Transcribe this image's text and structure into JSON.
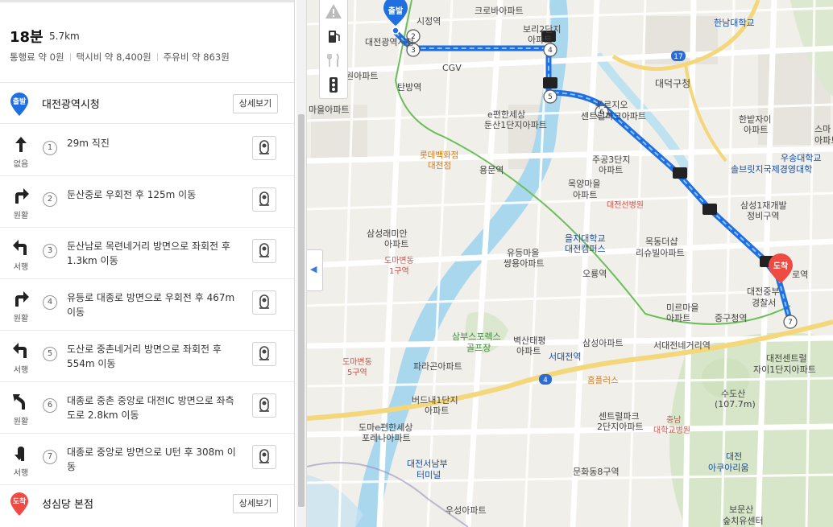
{
  "summary": {
    "duration": "18분",
    "distance": "5.7km",
    "toll": "통행료 약 0원",
    "taxi": "택시비 약 8,400원",
    "fuel": "주유비 약 863원"
  },
  "origin": {
    "badge": "출발",
    "name": "대전광역시청",
    "detail_label": "상세보기"
  },
  "destination": {
    "badge": "도착",
    "name": "성심당 본점",
    "detail_label": "상세보기"
  },
  "steps": [
    {
      "num": "1",
      "turn": "straight",
      "turn_label": "없음",
      "text": "29m 직진"
    },
    {
      "num": "2",
      "turn": "right",
      "turn_label": "원활",
      "text": "둔산중로 우회전 후 125m 이동"
    },
    {
      "num": "3",
      "turn": "left",
      "turn_label": "서행",
      "text": "둔산남로 목련네거리 방면으로 좌회전 후 1.3km 이동"
    },
    {
      "num": "4",
      "turn": "right",
      "turn_label": "원활",
      "text": "유등로 대종로 방면으로 우회전 후 467m 이동"
    },
    {
      "num": "5",
      "turn": "left",
      "turn_label": "서행",
      "text": "도산로 중촌네거리 방면으로 좌회전 후 554m 이동"
    },
    {
      "num": "6",
      "turn": "slight-left",
      "turn_label": "원활",
      "text": "대종로 중촌 중앙로 대전IC 방면으로 좌측도로 2.8km 이동"
    },
    {
      "num": "7",
      "turn": "u-turn",
      "turn_label": "서행",
      "text": "대종로 중앙로 방면으로 U턴 후 308m 이동"
    }
  ],
  "map_tools": [
    "warning-icon",
    "gas-station-icon",
    "restaurant-icon",
    "traffic-light-icon"
  ],
  "map": {
    "start_badge": "출발",
    "end_badge": "도착",
    "labels": {
      "daejeon_cityhall": "대전광역시청",
      "sijeong": "시정역",
      "crova": "크로바아파트",
      "bora": "보리2단지",
      "bora2": "아파트",
      "cgv": "CGV",
      "won_apt": "원아파트",
      "tanbang": "탄방역",
      "maeul": "마을아파트",
      "hannam": "한남대학교",
      "daedeok": "대덕구청",
      "pureujio1": "푸르지오",
      "pureujio2": "센트럴파크아파트",
      "epyeon1": "e편한세상",
      "epyeon2": "둔산1단지아파트",
      "hanbat1": "한밭자이",
      "hanbat2": "아파트",
      "smart1": "스마",
      "smart2": "아파트",
      "woosong1": "우송대학교",
      "woosong2": "솔브릿지국제경영대학",
      "lotte1": "롯데백화점",
      "lotte2": "대전점",
      "yongmun": "용문역",
      "jugong1": "주공3단지",
      "jugong2": "아파트",
      "mokyang1": "목양마을",
      "mokyang2": "아파트",
      "seon": "대전선병원",
      "samsung_ap1": "삼성1재개발",
      "samsung_ap2": "정비구역",
      "samsung_rae1": "삼성래미안",
      "samsung_rae2": "아파트",
      "eulji1": "을지대학교",
      "eulji2": "대전캠퍼스",
      "mokdong1": "목동더샵",
      "mokdong2": "리슈빌아파트",
      "doma1_1": "도마변동",
      "doma1_2": "1구역",
      "yudeung1": "유등마을",
      "yudeung2": "쌍용아파트",
      "ohryong": "오룡역",
      "jungchal1": "대전중부",
      "jungchal2": "경찰서",
      "miru1": "미르마을",
      "miru2": "아파트",
      "junggu": "중구청역",
      "samboo1": "삼부스포렉스",
      "samboo2": "골프장",
      "byeoksan1": "벽산태평",
      "byeoksan2": "아파트",
      "samsung_apt": "삼성아파트",
      "seodaejeon_ne": "서대전네거리역",
      "seodaejeon_st": "서대전역",
      "central1": "대전센트럴",
      "central2": "자이1단지아파트",
      "doma5_1": "도마변동",
      "doma5_2": "5구역",
      "paragon": "파라곤아파트",
      "homeplus": "홈플러스",
      "sudosan1": "수도산",
      "sudosan2": "(107.7m)",
      "budnae1": "버드내1단지",
      "budnae2": "아파트",
      "central_park1": "센트럴파크",
      "central_park2": "2단지아파트",
      "chungnam1": "충남",
      "chungnam2": "대학교병원",
      "epyeon_dom1": "도마e편한세상",
      "epyeon_dom2": "포레나아파트",
      "terminal1": "대전서남부",
      "terminal2": "터미널",
      "munhwa": "문화동8구역",
      "ausement1": "대전",
      "ausement2": "아쿠아리움",
      "woosung": "우성아파트",
      "bomunsan1": "보문산",
      "bomunsan2": "숲치유센터",
      "dolo": "로역",
      "road_4": "4",
      "road_17": "17"
    }
  }
}
